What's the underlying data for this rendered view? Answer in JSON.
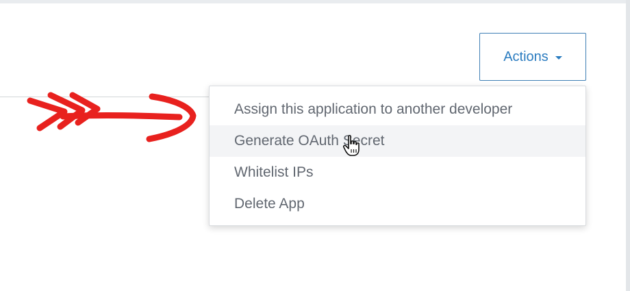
{
  "header": {
    "actions_button_label": "Actions",
    "actions_caret_icon": "caret-down-icon"
  },
  "actions_menu": {
    "items": [
      {
        "label": "Assign this application to another developer"
      },
      {
        "label": "Generate OAuth Secret",
        "hovered": true
      },
      {
        "label": "Whitelist IPs"
      },
      {
        "label": "Delete App"
      }
    ]
  },
  "annotation": {
    "type": "hand-drawn-arrow",
    "color": "#e8211e"
  },
  "cursor": {
    "type": "hand-pointer-icon"
  },
  "colors": {
    "accent": "#2b7cc0",
    "menu_text": "#616770",
    "hover_background": "#f3f4f6"
  }
}
